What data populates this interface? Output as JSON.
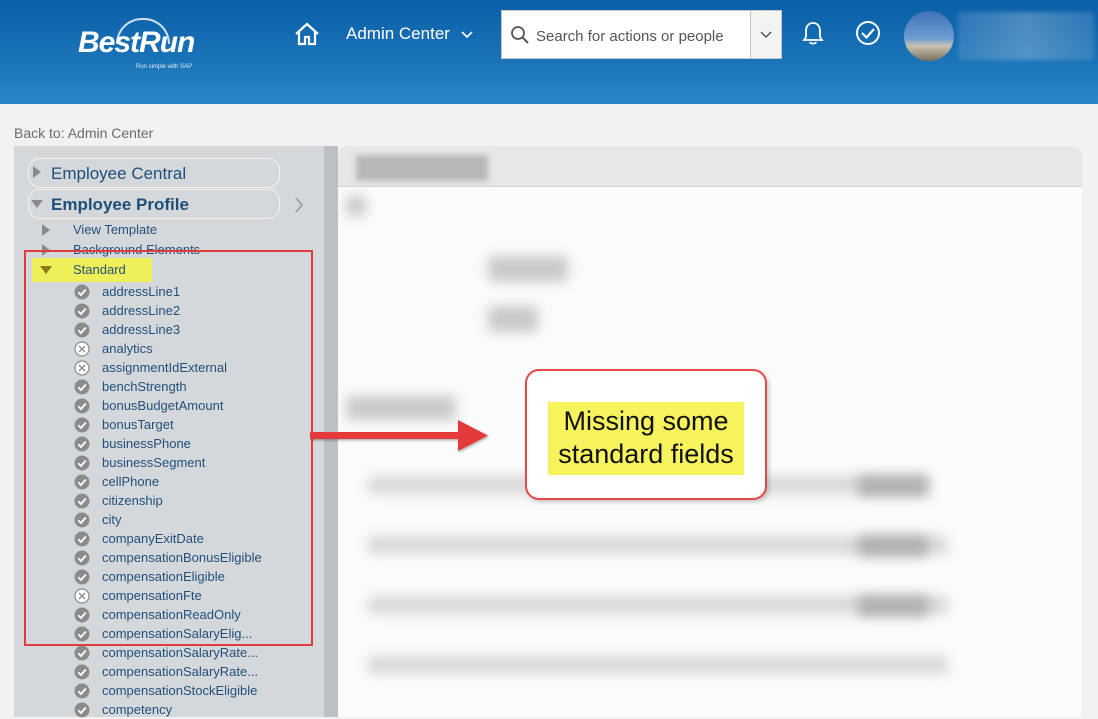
{
  "header": {
    "logo_text": "BestRun",
    "logo_tagline": "Run simple with SAP",
    "module_label": "Admin Center",
    "search_placeholder": "Search for actions or people"
  },
  "breadcrumb": {
    "back_label": "Back to: Admin Center"
  },
  "tree": {
    "sections": [
      {
        "label": "Employee Central",
        "expanded": false
      },
      {
        "label": "Employee Profile",
        "expanded": true
      }
    ],
    "subnodes": [
      {
        "label": "View Template"
      },
      {
        "label": "Background Elements"
      },
      {
        "label": "Standard"
      }
    ],
    "fields": [
      {
        "label": "addressLine1",
        "status": "enabled"
      },
      {
        "label": "addressLine2",
        "status": "enabled"
      },
      {
        "label": "addressLine3",
        "status": "enabled"
      },
      {
        "label": "analytics",
        "status": "disabled"
      },
      {
        "label": "assignmentIdExternal",
        "status": "disabled"
      },
      {
        "label": "benchStrength",
        "status": "enabled"
      },
      {
        "label": "bonusBudgetAmount",
        "status": "enabled"
      },
      {
        "label": "bonusTarget",
        "status": "enabled"
      },
      {
        "label": "businessPhone",
        "status": "enabled"
      },
      {
        "label": "businessSegment",
        "status": "enabled"
      },
      {
        "label": "cellPhone",
        "status": "enabled"
      },
      {
        "label": "citizenship",
        "status": "enabled"
      },
      {
        "label": "city",
        "status": "enabled"
      },
      {
        "label": "companyExitDate",
        "status": "enabled"
      },
      {
        "label": "compensationBonusEligible",
        "status": "enabled"
      },
      {
        "label": "compensationEligible",
        "status": "enabled"
      },
      {
        "label": "compensationFte",
        "status": "disabled"
      },
      {
        "label": "compensationReadOnly",
        "status": "enabled"
      },
      {
        "label": "compensationSalaryElig...",
        "status": "enabled"
      },
      {
        "label": "compensationSalaryRate...",
        "status": "enabled"
      },
      {
        "label": "compensationSalaryRate...",
        "status": "enabled"
      },
      {
        "label": "compensationStockEligible",
        "status": "enabled"
      },
      {
        "label": "competency",
        "status": "enabled"
      }
    ]
  },
  "annotation": {
    "callout_text": "Missing some standard fields",
    "highlight_color": "#f7f35c",
    "border_color": "#e34848"
  },
  "colors": {
    "header_blue": "#0a5fa8",
    "link_blue": "#21507b"
  }
}
